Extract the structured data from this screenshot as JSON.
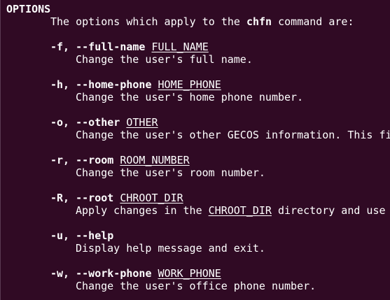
{
  "section_heading": "OPTIONS",
  "intro": {
    "before": "The options which apply to the ",
    "command": "chfn",
    "after": " command are:"
  },
  "options": [
    {
      "short": "-f,",
      "long": "--full-name",
      "arg": "FULL_NAME",
      "description": "Change the user's full name."
    },
    {
      "short": "-h,",
      "long": "--home-phone",
      "arg": "HOME_PHONE",
      "description": "Change the user's home phone number."
    },
    {
      "short": "-o,",
      "long": "--other",
      "arg": "OTHER",
      "description": "Change the user's other GECOS information. This fi"
    },
    {
      "short": "-r,",
      "long": "--room",
      "arg": "ROOM_NUMBER",
      "description": "Change the user's room number."
    },
    {
      "short": "-R,",
      "long": "--root",
      "arg": "CHROOT_DIR",
      "description_before": "Apply changes in the ",
      "description_arg": "CHROOT_DIR",
      "description_after": " directory and use"
    },
    {
      "short": "-u,",
      "long": "--help",
      "description": "Display help message and exit."
    },
    {
      "short": "-w,",
      "long": "--work-phone",
      "arg": "WORK_PHONE",
      "description": "Change the user's office phone number."
    }
  ],
  "colors": {
    "background": "#300a24",
    "foreground": "#ffffff"
  }
}
